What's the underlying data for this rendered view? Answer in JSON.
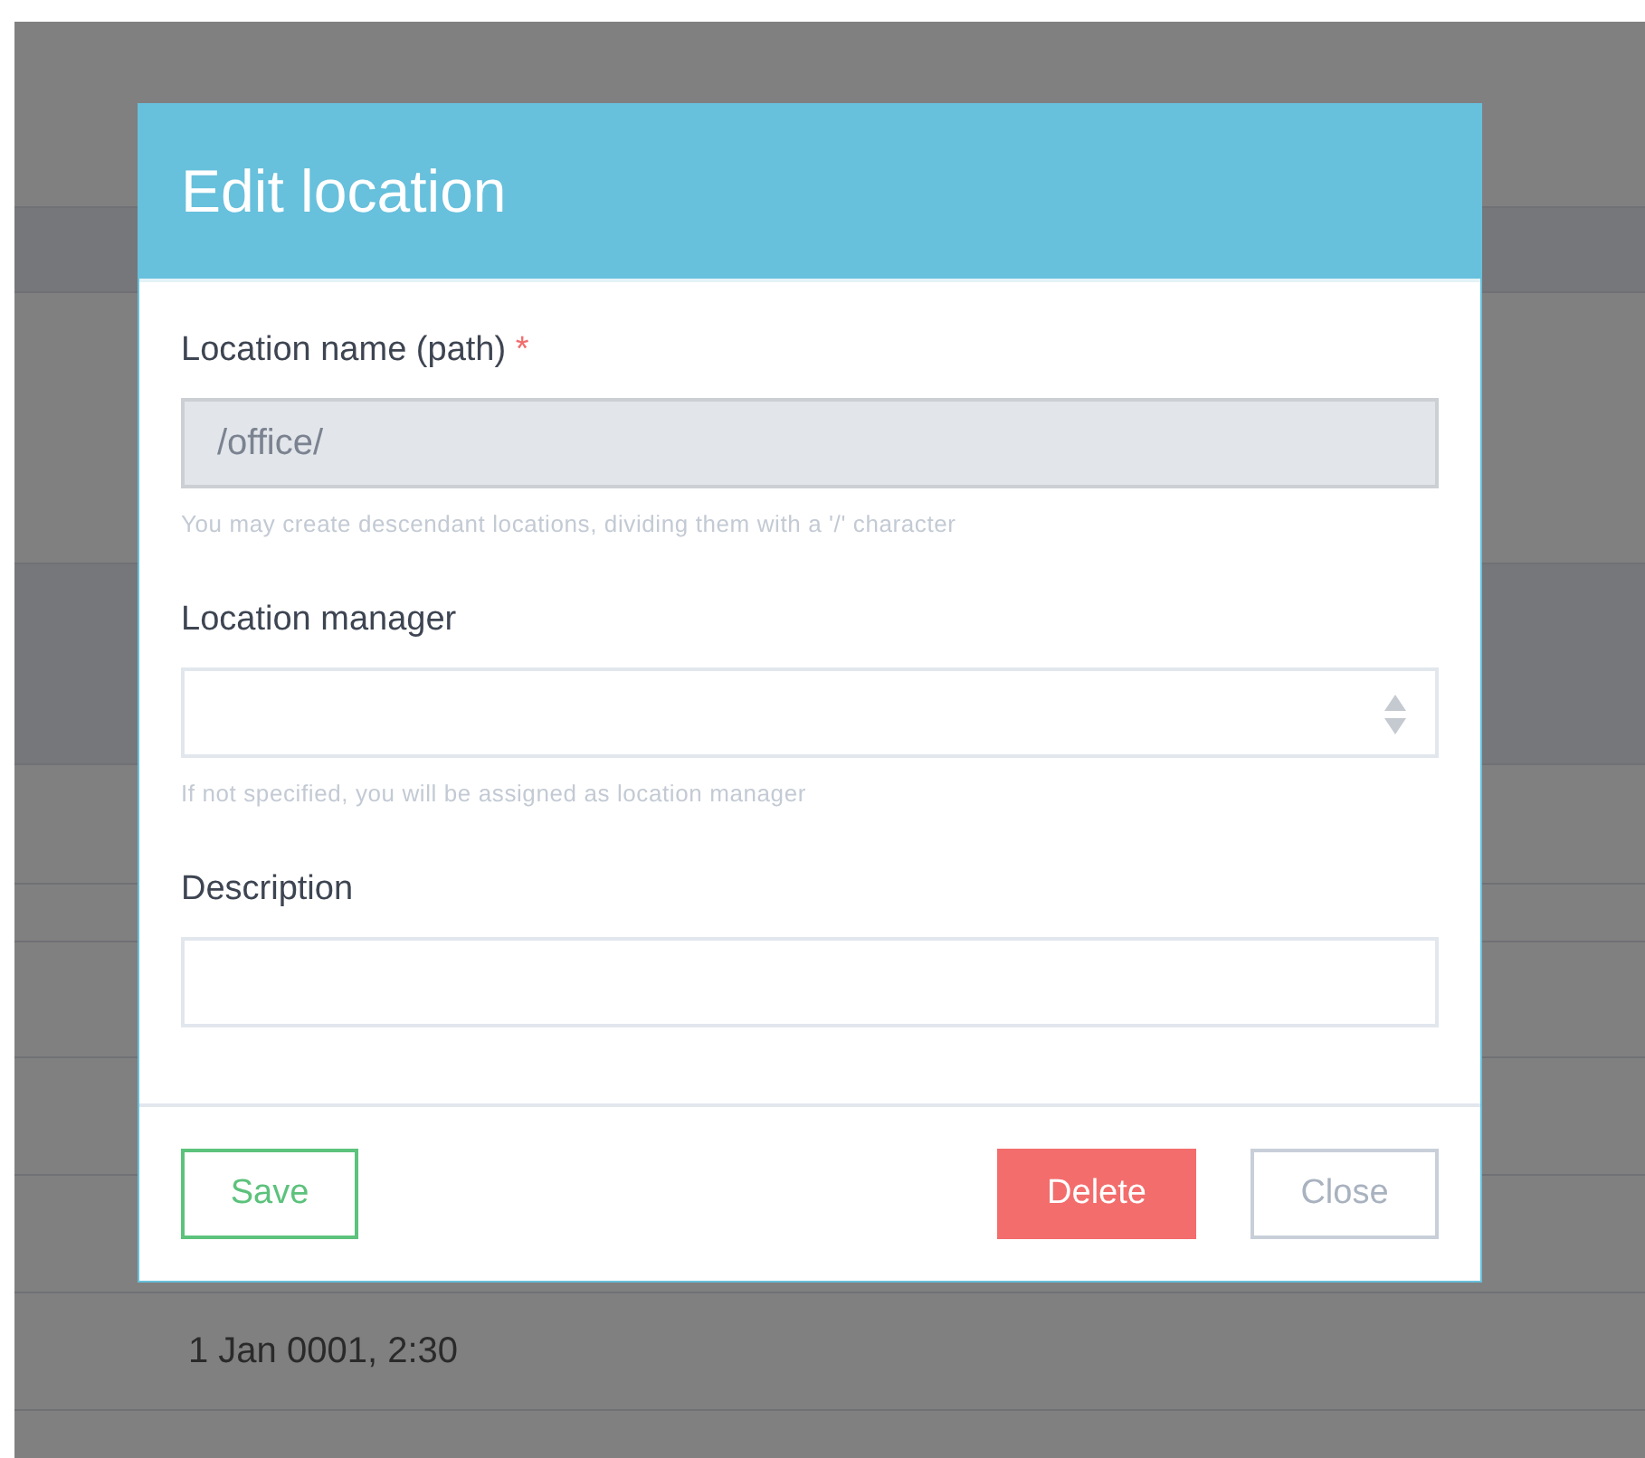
{
  "page_behind": {
    "date_cell": "1 Jan 0001, 2:30"
  },
  "dialog": {
    "title": "Edit location",
    "fields": [
      {
        "kind": "input",
        "label": "Location name (path)",
        "required_mark": "*",
        "value": "/office/",
        "disabled": true,
        "hint": "You may create descendant locations, dividing them with a '/' character"
      },
      {
        "kind": "select",
        "label": "Location manager",
        "disabled": false,
        "hint": "If not specified, you will be assigned as location manager"
      },
      {
        "kind": "textarea",
        "label": "Description",
        "disabled": false
      }
    ],
    "buttons": [
      {
        "label": "Save",
        "kind": "save"
      },
      {
        "label": "Delete",
        "kind": "danger"
      },
      {
        "label": "Close",
        "kind": "close"
      }
    ]
  }
}
